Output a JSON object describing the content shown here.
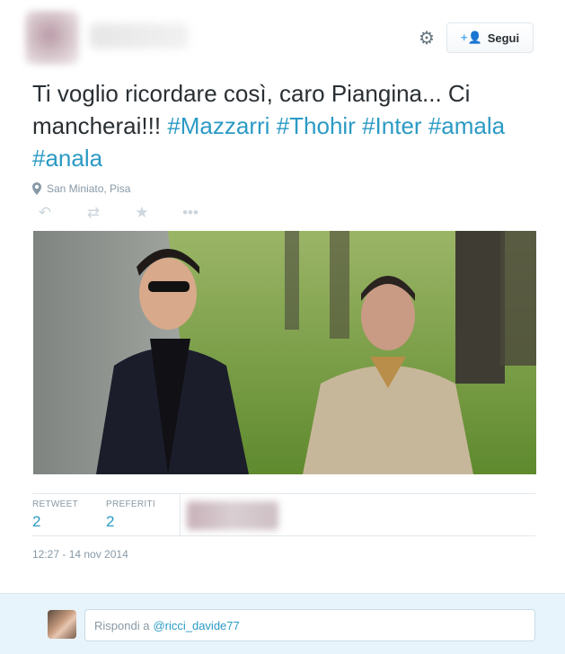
{
  "header": {
    "follow_label": "Segui",
    "icons": {
      "settings": "gear-icon",
      "follow": "add-user-icon"
    }
  },
  "tweet": {
    "text_plain": "Ti voglio ricordare così, caro Piangina... Ci mancherai!!!",
    "hashtags": [
      "#Mazzarri",
      "#Thohir",
      "#Inter",
      "#amala",
      "#anala"
    ],
    "location": "San Miniato, Pisa",
    "action_icons": [
      "reply-icon",
      "retweet-icon",
      "favorite-icon",
      "more-icon"
    ]
  },
  "stats": {
    "retweet_label": "RETWEET",
    "retweet_count": "2",
    "favorites_label": "PREFERITI",
    "favorites_count": "2"
  },
  "timestamp": "12:27 - 14 nov 2014",
  "reply": {
    "prefix": "Rispondi a",
    "mention": "@ricci_davide77"
  },
  "colors": {
    "link": "#2b9ac4",
    "muted": "#8899a6",
    "text": "#292f33",
    "reply_bar": "#e8f4fb"
  }
}
